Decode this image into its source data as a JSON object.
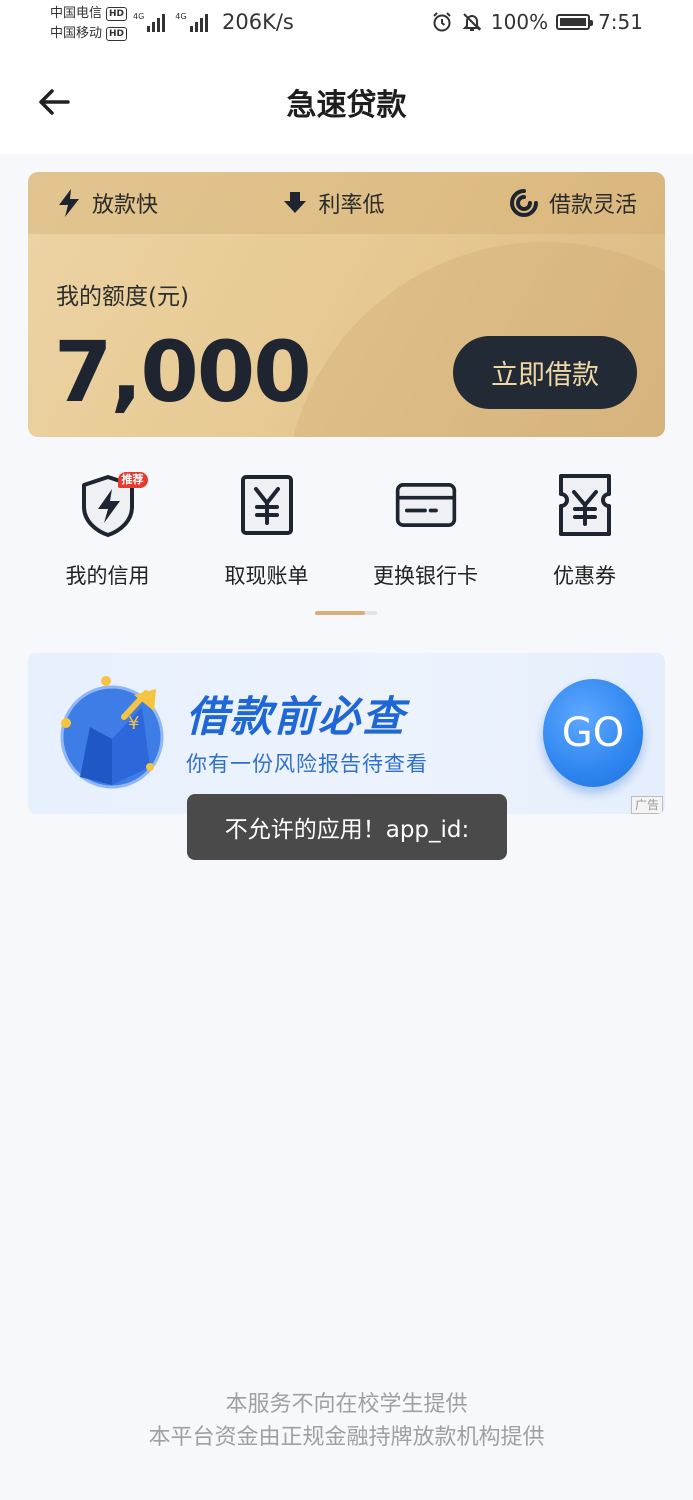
{
  "status_bar": {
    "carrier_1": "中国电信",
    "carrier_2": "中国移动",
    "hd_badge": "HD",
    "network_1": "4G",
    "network_2": "4G",
    "net_speed": "206K/s",
    "battery": "100%",
    "time": "7:51",
    "icons": [
      "alarm-icon",
      "bell-muted-icon",
      "battery-icon"
    ]
  },
  "header": {
    "title": "急速贷款",
    "back_icon": "arrow-left-icon"
  },
  "credit_card": {
    "features": [
      {
        "label": "放款快",
        "icon": "lightning-icon"
      },
      {
        "label": "利率低",
        "icon": "arrow-down-icon"
      },
      {
        "label": "借款灵活",
        "icon": "swirl-icon"
      }
    ],
    "quota_label": "我的额度(元)",
    "quota_amount": "7,000",
    "borrow_button": "立即借款"
  },
  "quick_menu": {
    "items": [
      {
        "label": "我的信用",
        "icon": "shield-lightning-icon",
        "badge": "推荐"
      },
      {
        "label": "取现账单",
        "icon": "yuan-bill-icon"
      },
      {
        "label": "更换银行卡",
        "icon": "bank-card-icon"
      },
      {
        "label": "优惠券",
        "icon": "yuan-coupon-icon"
      }
    ]
  },
  "ad_banner": {
    "title": "借款前必查",
    "subtitle": "你有一份风险报告待查看",
    "button": "GO",
    "tag": "广告"
  },
  "toast": {
    "message": "不允许的应用！app_id:"
  },
  "footer": {
    "line_1": "本服务不向在校学生提供",
    "line_2": "本平台资金由正规金融持牌放款机构提供"
  },
  "colors": {
    "card_gold": "#e6c891",
    "button_dark": "#222a35",
    "button_text": "#f0d7a6",
    "ad_blue": "#1f67d6",
    "toast_bg": "#4a4a4a"
  }
}
